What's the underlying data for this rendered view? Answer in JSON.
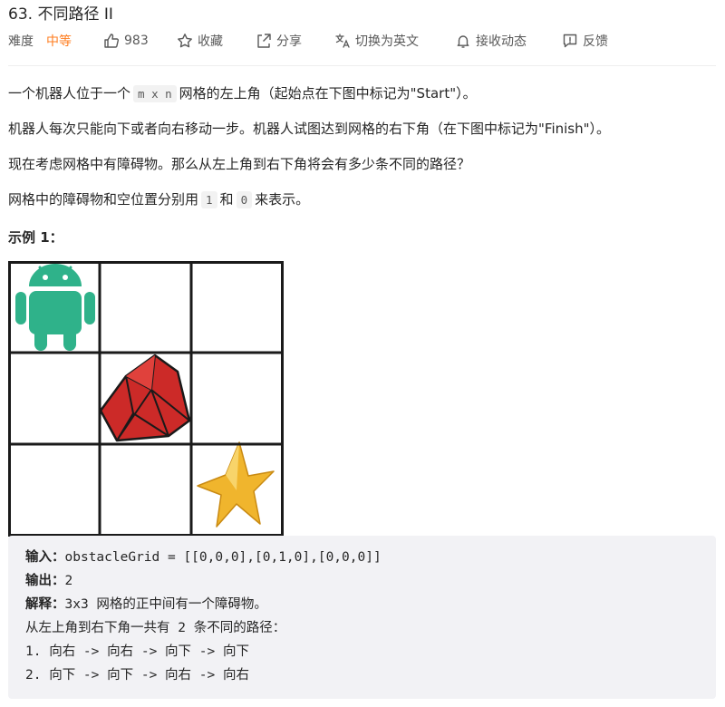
{
  "problem": {
    "title": "63. 不同路径 II"
  },
  "meta": {
    "difficulty_label": "难度",
    "difficulty_value": "中等",
    "likes": "983",
    "favorite": "收藏",
    "share": "分享",
    "translate": "切换为英文",
    "follow": "接收动态",
    "feedback": "反馈"
  },
  "description": {
    "p1_before": "一个机器人位于一个",
    "p1_code": "m x n",
    "p1_after": "网格的左上角（起始点在下图中标记为\"Start\"）。",
    "p2": "机器人每次只能向下或者向右移动一步。机器人试图达到网格的右下角（在下图中标记为\"Finish\"）。",
    "p3": "现在考虑网格中有障碍物。那么从左上角到右下角将会有多少条不同的路径？",
    "p4_before": "网格中的障碍物和空位置分别用",
    "p4_code1": "1",
    "p4_mid": "和",
    "p4_code2": "0",
    "p4_after": "来表示。"
  },
  "example": {
    "heading": "示例 1：",
    "grid": [
      [
        0,
        0,
        0
      ],
      [
        0,
        1,
        0
      ],
      [
        0,
        0,
        0
      ]
    ],
    "input_label": "输入：",
    "input_value": "obstacleGrid = [[0,0,0],[0,1,0],[0,0,0]]",
    "output_label": "输出：",
    "output_value": "2",
    "explain_label": "解释：",
    "explain_value": "3x3 网格的正中间有一个障碍物。",
    "line2": "从左上角到右下角一共有 2 条不同的路径：",
    "line3": "1. 向右 -> 向右 -> 向下 -> 向下",
    "line4": "2. 向下 -> 向下 -> 向右 -> 向右"
  },
  "colors": {
    "accent": "#ff7d1f",
    "android": "#3ddc84",
    "android_teal": "#2fb28a",
    "ruby": "#cc2a28",
    "star": "#f0b52d"
  },
  "icons": [
    "thumbs-up-icon",
    "star-outline-icon",
    "share-icon",
    "translate-icon",
    "bell-icon",
    "feedback-icon"
  ]
}
